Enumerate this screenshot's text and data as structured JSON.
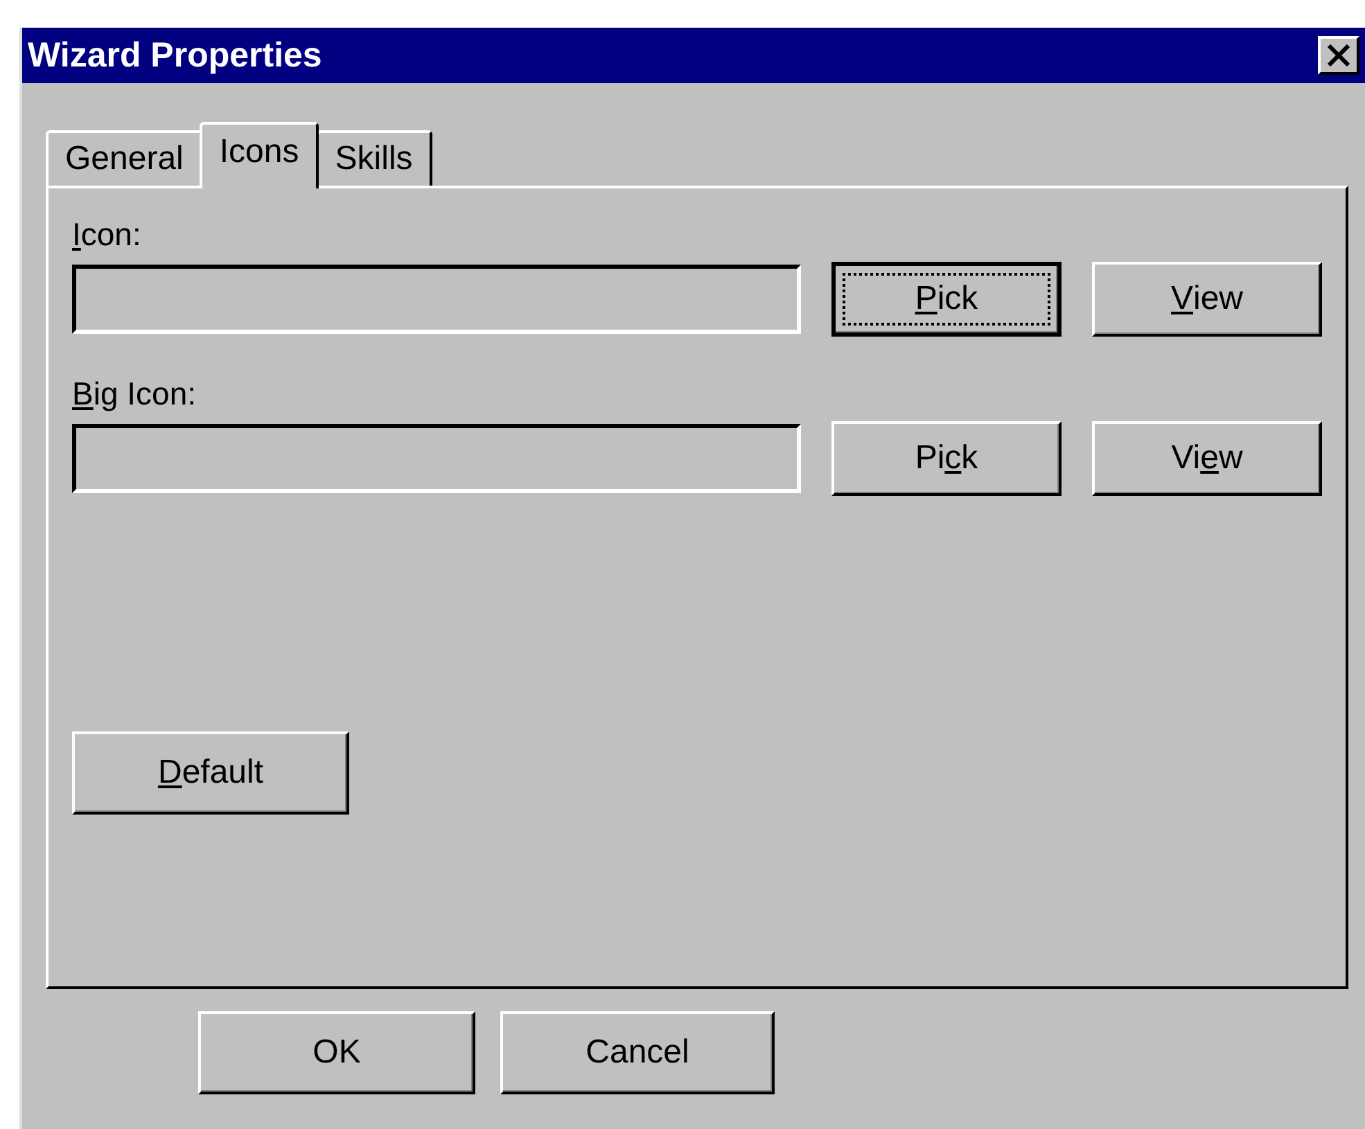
{
  "window": {
    "title": "Wizard Properties"
  },
  "tabs": [
    {
      "label": "General",
      "selected": false
    },
    {
      "label": "Icons",
      "selected": true
    },
    {
      "label": "Skills",
      "selected": false
    }
  ],
  "fields": [
    {
      "label": [
        {
          "text": "I",
          "underlined": true
        },
        {
          "text": "con:",
          "underlined": false
        }
      ],
      "buttons": [
        {
          "label": [
            {
              "text": "P",
              "underlined": true
            },
            {
              "text": "ick",
              "underlined": false
            }
          ],
          "focused": true
        },
        {
          "label": [
            {
              "text": "V",
              "underlined": true
            },
            {
              "text": "iew",
              "underlined": false
            }
          ],
          "focused": false
        }
      ]
    },
    {
      "label": [
        {
          "text": "B",
          "underlined": true
        },
        {
          "text": "ig Icon:",
          "underlined": false
        }
      ],
      "buttons": [
        {
          "label": [
            {
              "text": "Pi",
              "underlined": false
            },
            {
              "text": "c",
              "underlined": true
            },
            {
              "text": "k",
              "underlined": false
            }
          ],
          "focused": false
        },
        {
          "label": [
            {
              "text": "Vi",
              "underlined": false
            },
            {
              "text": "e",
              "underlined": true
            },
            {
              "text": "w",
              "underlined": false
            }
          ],
          "focused": false
        }
      ]
    }
  ],
  "default_button": {
    "label": [
      {
        "text": "D",
        "underlined": true
      },
      {
        "text": "efault",
        "underlined": false
      }
    ]
  },
  "footer_buttons": [
    {
      "label": "OK"
    },
    {
      "label": "Cancel"
    }
  ]
}
